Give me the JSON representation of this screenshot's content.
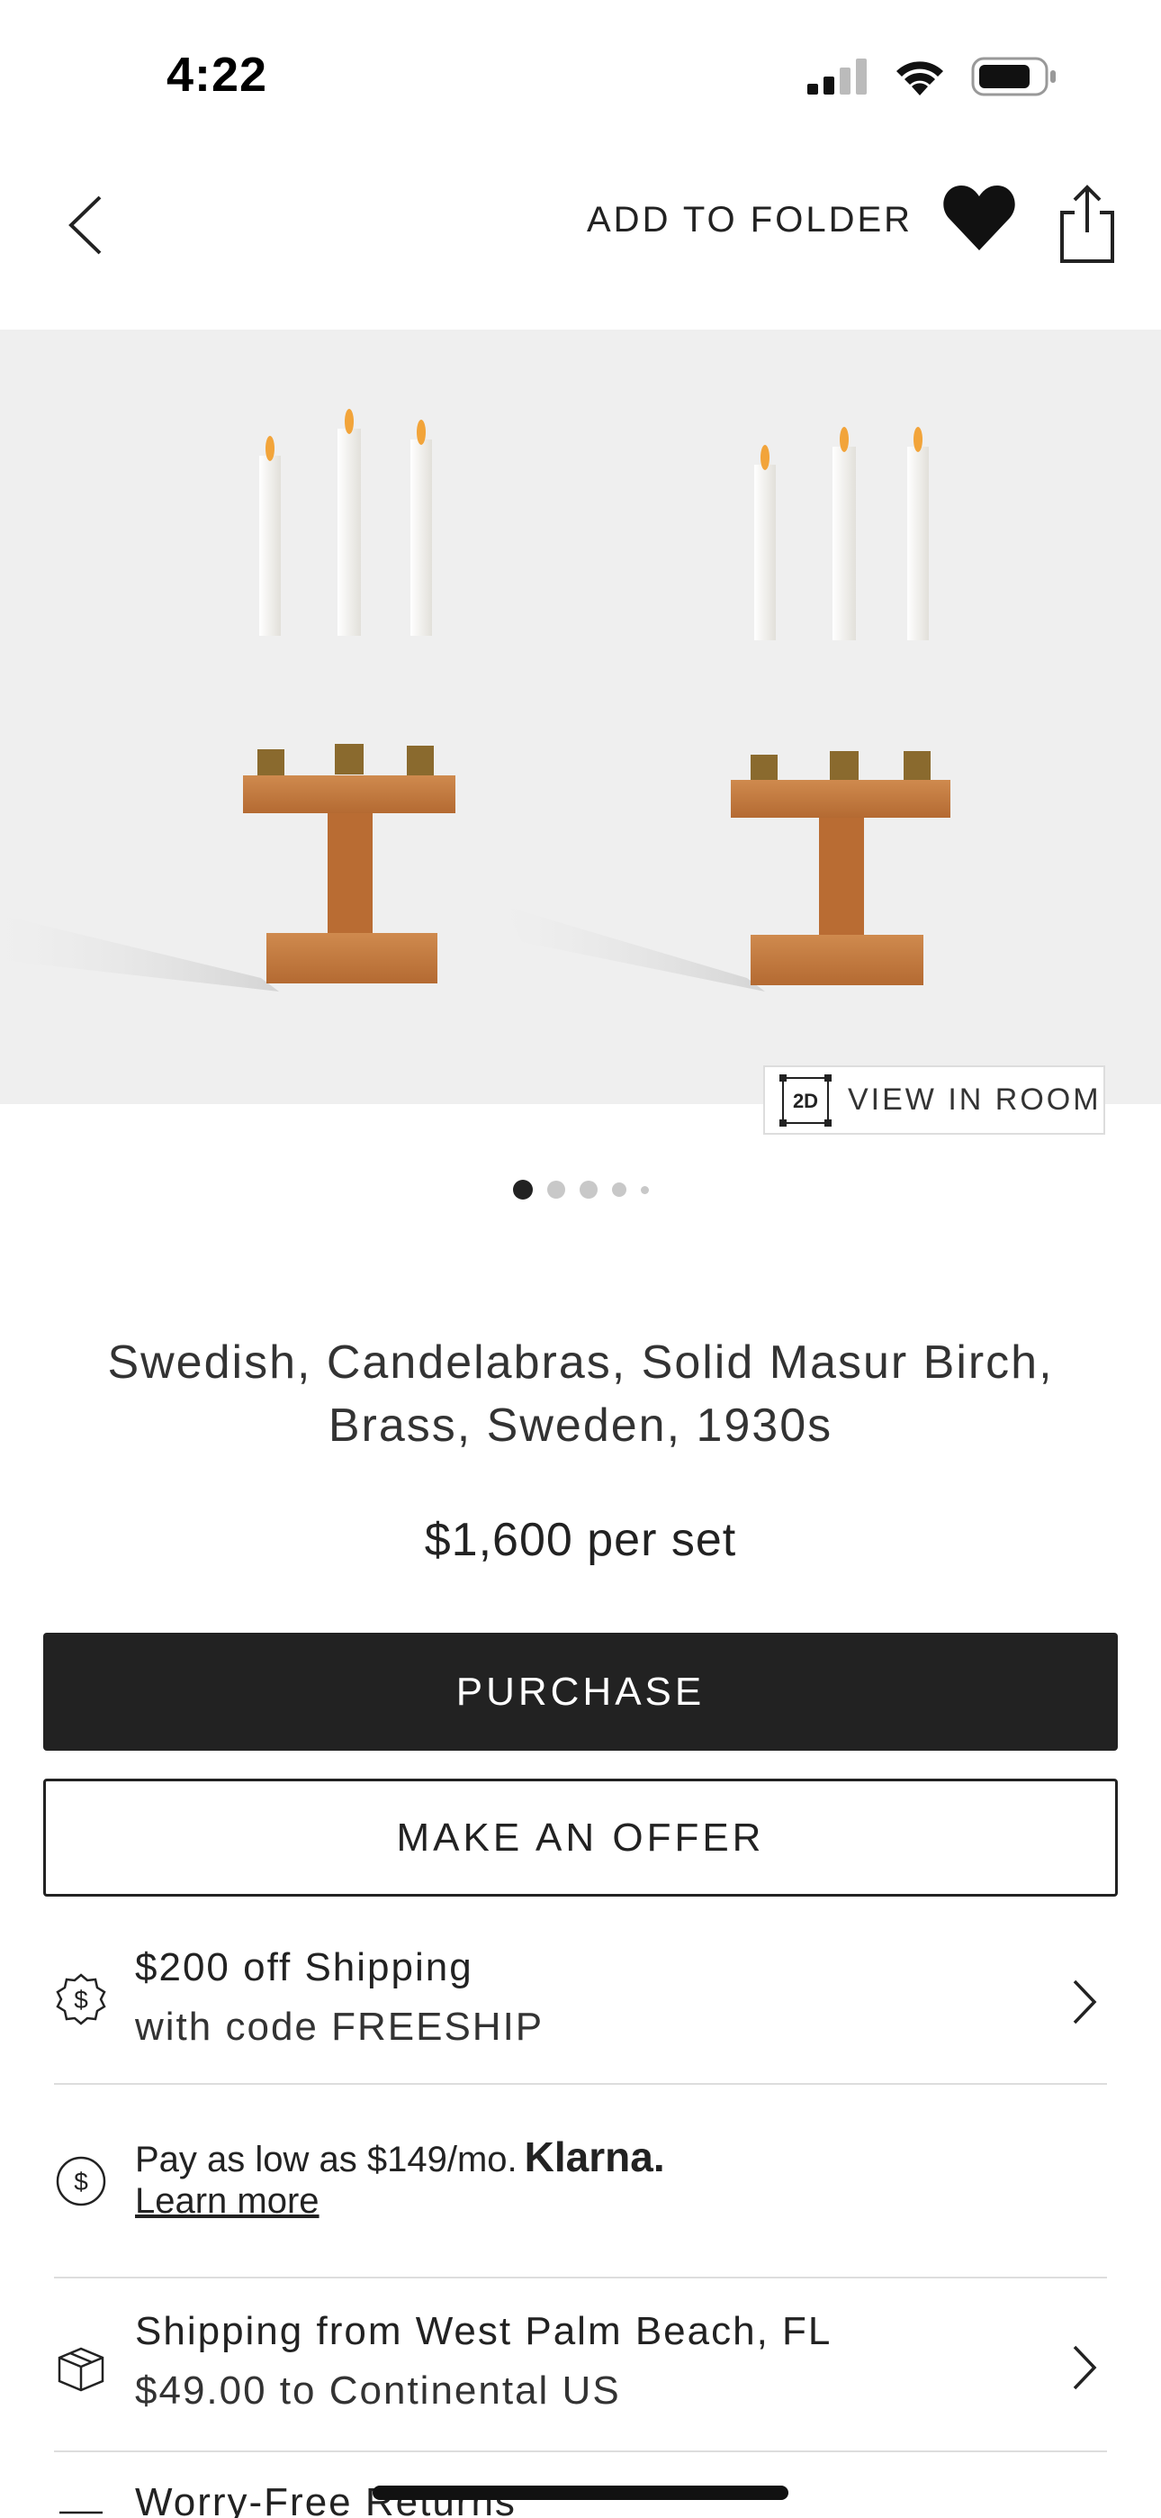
{
  "status_bar": {
    "time": "4:22"
  },
  "nav": {
    "add_to_folder": "ADD TO FOLDER"
  },
  "gallery": {
    "view_in_room_badge": "2D",
    "view_in_room": "VIEW IN ROOM",
    "page_count": 5,
    "current_page": 1
  },
  "product": {
    "title_line1": "Swedish, Candelabras, Solid Masur Birch,",
    "title_line2": "Brass, Sweden, 1930s",
    "price": "$1,600 per set"
  },
  "actions": {
    "purchase": "PURCHASE",
    "make_offer": "MAKE AN OFFER"
  },
  "promo": {
    "line1": "$200 off Shipping",
    "line2": "with code FREESHIP"
  },
  "financing": {
    "text": "Pay as low as $149/mo.",
    "brand": "Klarna.",
    "link": "Learn more"
  },
  "shipping": {
    "line1": "Shipping from West Palm Beach, FL",
    "line2": "$49.00 to Continental US"
  },
  "returns": {
    "line1": "Worry-Free Returns"
  },
  "colors": {
    "primary_button": "#222222",
    "hero_background": "#efefef",
    "wood": "#c0763c",
    "brass": "#8a6a2e"
  }
}
